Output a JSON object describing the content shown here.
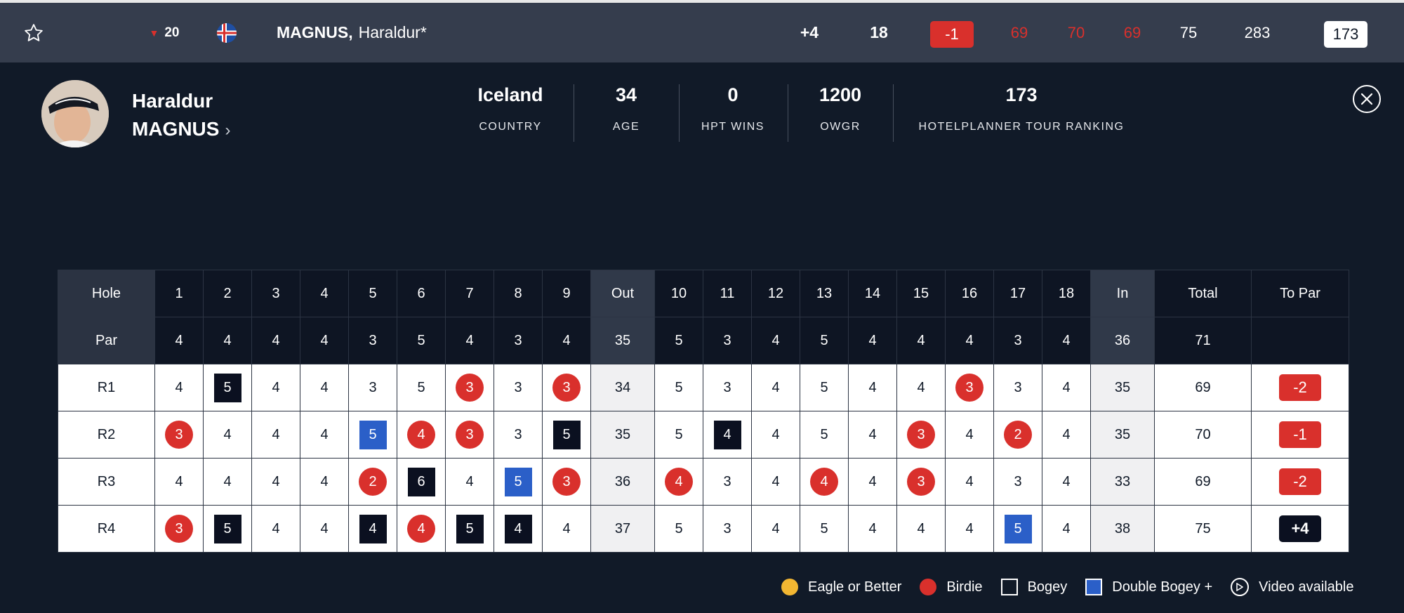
{
  "topbar": {
    "position": "20",
    "country_flag": "iceland-flag",
    "last_name": "MAGNUS,",
    "first_name": "Haraldur*",
    "to_par": "+4",
    "thru": "18",
    "today": "-1",
    "rounds": [
      "69",
      "70",
      "69",
      "75"
    ],
    "total": "283",
    "ranking": "173"
  },
  "player": {
    "first_name": "Haraldur",
    "last_name": "MAGNUS",
    "stats": [
      {
        "value": "Iceland",
        "label": "COUNTRY"
      },
      {
        "value": "34",
        "label": "AGE"
      },
      {
        "value": "0",
        "label": "HPT WINS"
      },
      {
        "value": "1200",
        "label": "OWGR"
      },
      {
        "value": "173",
        "label": "HOTELPLANNER TOUR RANKING"
      }
    ]
  },
  "scorecard": {
    "headers": [
      "Hole",
      "1",
      "2",
      "3",
      "4",
      "5",
      "6",
      "7",
      "8",
      "9",
      "Out",
      "10",
      "11",
      "12",
      "13",
      "14",
      "15",
      "16",
      "17",
      "18",
      "In",
      "Total",
      "To Par"
    ],
    "par_label": "Par",
    "par": [
      "4",
      "4",
      "4",
      "4",
      "3",
      "5",
      "4",
      "3",
      "4",
      "35",
      "5",
      "3",
      "4",
      "5",
      "4",
      "4",
      "4",
      "3",
      "4",
      "36",
      "71",
      ""
    ],
    "rounds": [
      {
        "label": "R1",
        "scores": [
          "4",
          "5",
          "4",
          "4",
          "3",
          "5",
          "3",
          "3",
          "3",
          "34",
          "5",
          "3",
          "4",
          "5",
          "4",
          "4",
          "3",
          "3",
          "4",
          "35",
          "69"
        ],
        "to_par": "-2"
      },
      {
        "label": "R2",
        "scores": [
          "3",
          "4",
          "4",
          "4",
          "5",
          "4",
          "3",
          "3",
          "5",
          "35",
          "5",
          "4",
          "4",
          "5",
          "4",
          "3",
          "4",
          "2",
          "4",
          "35",
          "70"
        ],
        "to_par": "-1"
      },
      {
        "label": "R3",
        "scores": [
          "4",
          "4",
          "4",
          "4",
          "2",
          "6",
          "4",
          "5",
          "3",
          "36",
          "4",
          "3",
          "4",
          "4",
          "4",
          "3",
          "4",
          "3",
          "4",
          "33",
          "69"
        ],
        "to_par": "-2"
      },
      {
        "label": "R4",
        "scores": [
          "3",
          "5",
          "4",
          "4",
          "4",
          "4",
          "5",
          "4",
          "4",
          "37",
          "5",
          "3",
          "4",
          "5",
          "4",
          "4",
          "4",
          "5",
          "4",
          "38",
          "75"
        ],
        "to_par": "+4"
      }
    ]
  },
  "legend": {
    "eagle": "Eagle or Better",
    "birdie": "Birdie",
    "bogey": "Bogey",
    "double_bogey": "Double Bogey +",
    "video": "Video available"
  },
  "colors": {
    "background": "#111a28",
    "topbar": "#353d4d",
    "birdie": "#d9302c",
    "bogey": "#0b1020",
    "double_bogey": "#2b5fc8",
    "eagle": "#f2b632"
  }
}
